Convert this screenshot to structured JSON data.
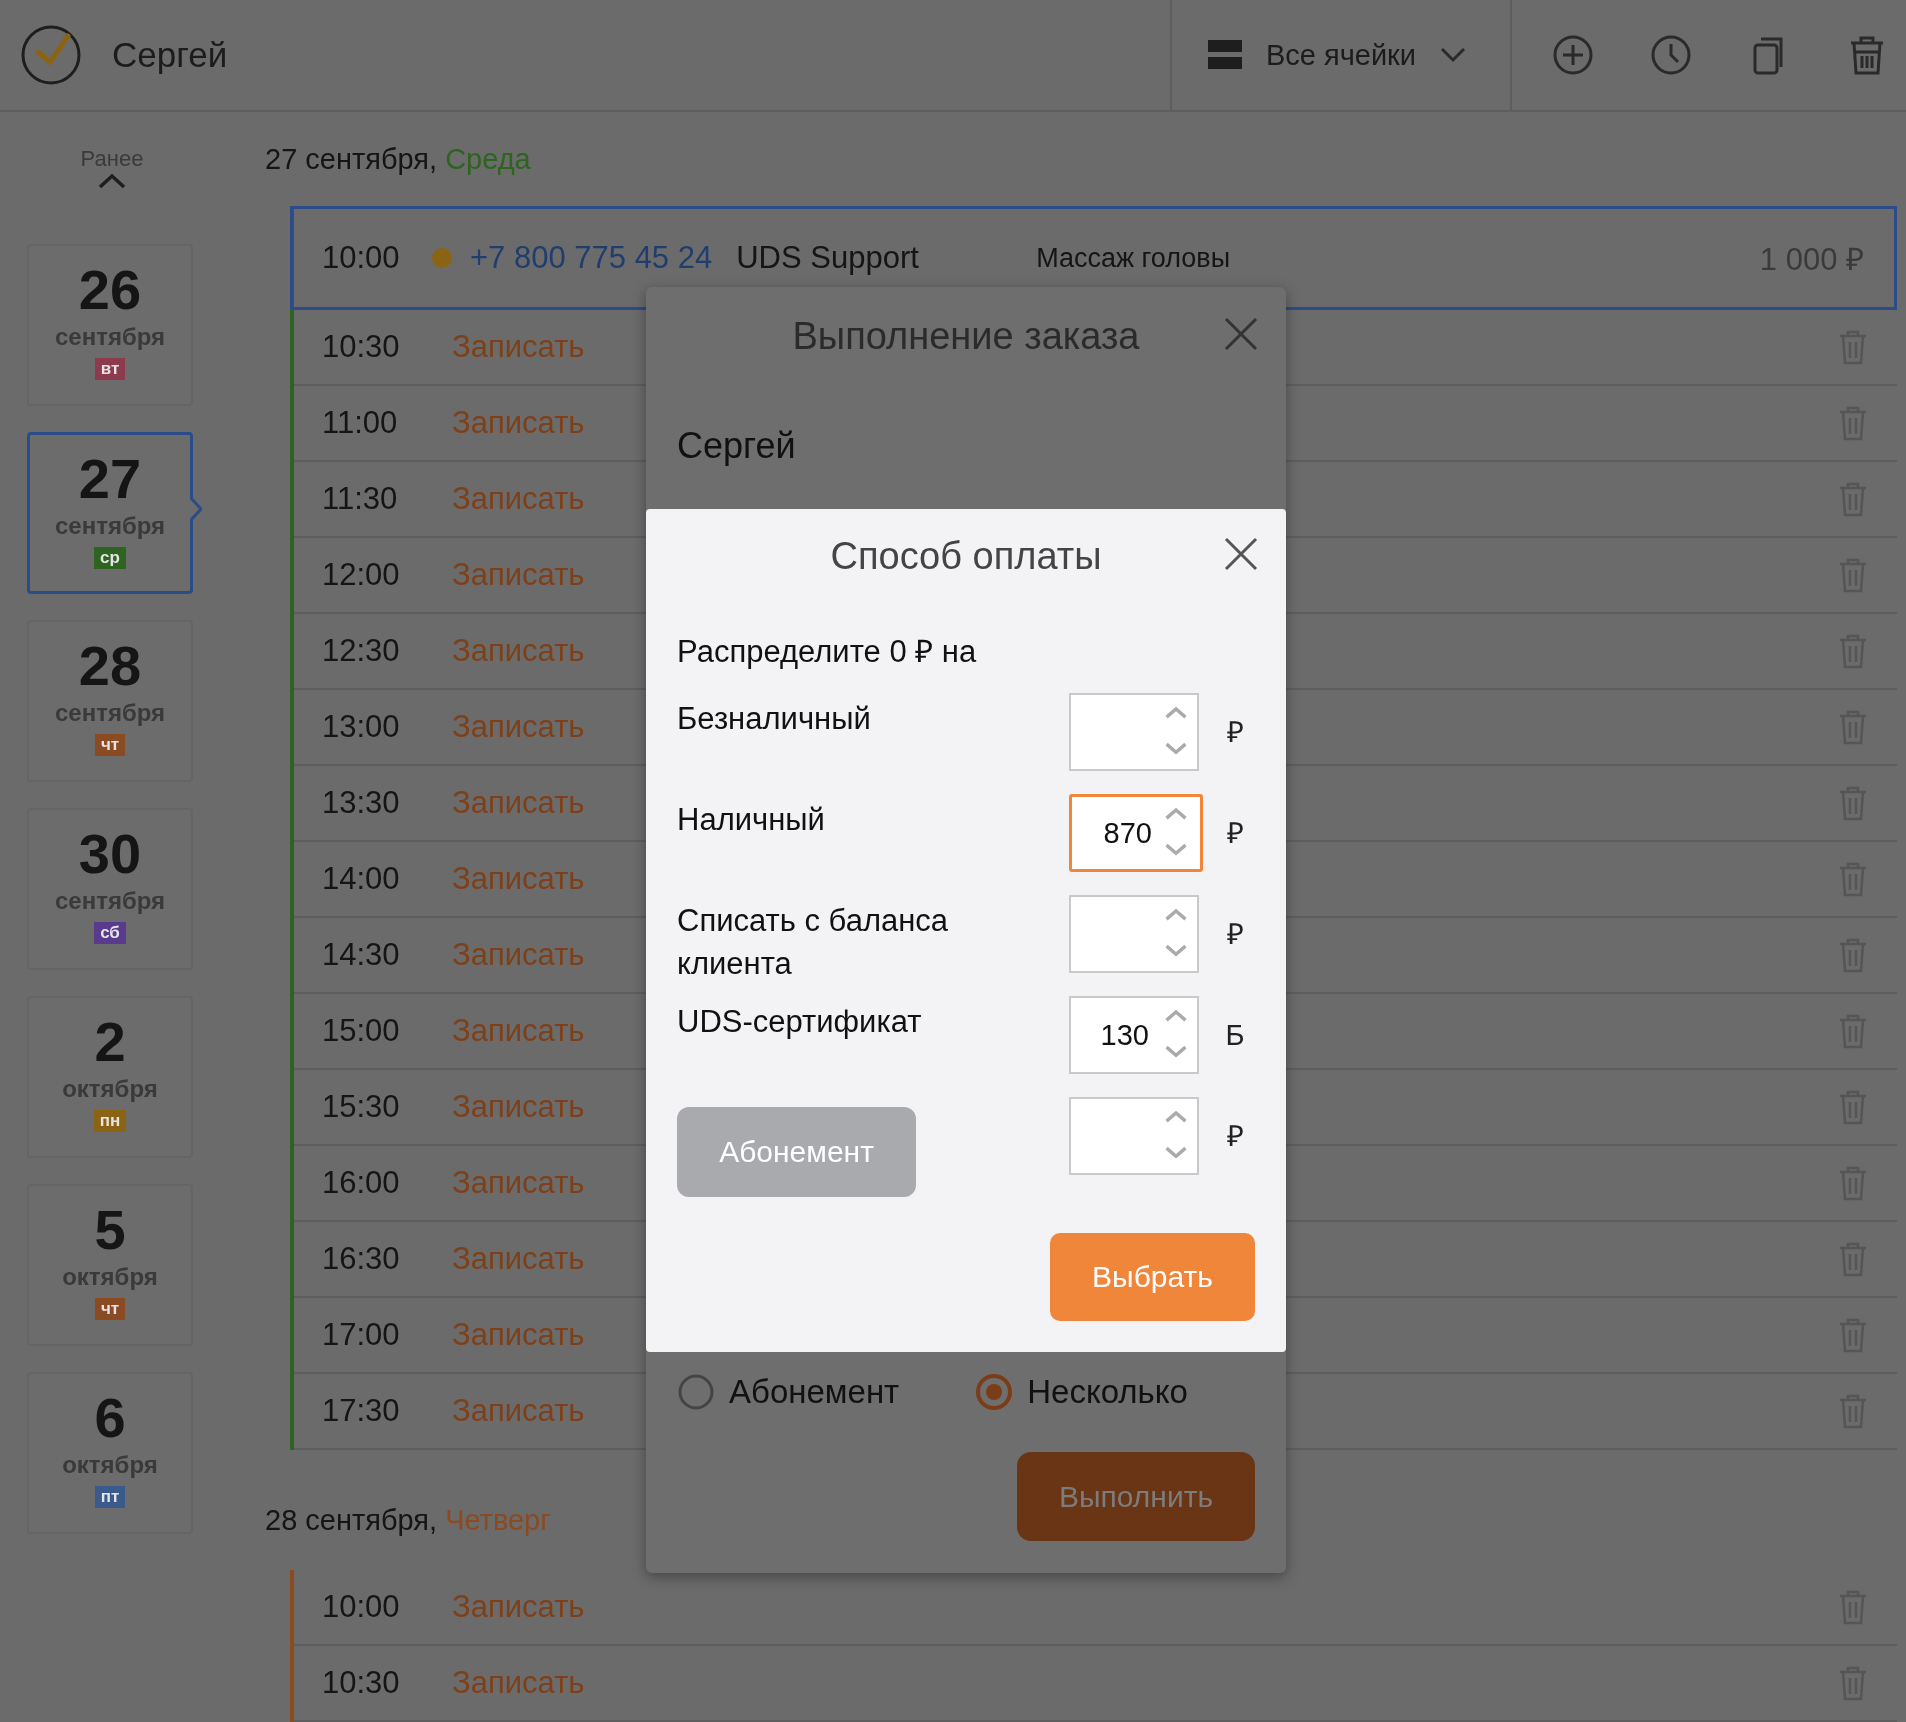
{
  "header": {
    "user_name": "Сергей",
    "filter_label": "Все ячейки"
  },
  "sidebar": {
    "earlier_label": "Ранее",
    "days": [
      {
        "day": "26",
        "month": "сентября",
        "weekday": "вт",
        "color": "#8c3a4c",
        "selected": false
      },
      {
        "day": "27",
        "month": "сентября",
        "weekday": "ср",
        "color": "#2c6420",
        "selected": true
      },
      {
        "day": "28",
        "month": "сентября",
        "weekday": "чт",
        "color": "#8a4a22",
        "selected": false
      },
      {
        "day": "30",
        "month": "сентября",
        "weekday": "сб",
        "color": "#5a3a8c",
        "selected": false
      },
      {
        "day": "2",
        "month": "октября",
        "weekday": "пн",
        "color": "#8a6412",
        "selected": false
      },
      {
        "day": "5",
        "month": "октября",
        "weekday": "чт",
        "color": "#8a4a22",
        "selected": false
      },
      {
        "day": "6",
        "month": "октября",
        "weekday": "пт",
        "color": "#3a5a8c",
        "selected": false
      }
    ]
  },
  "schedule": [
    {
      "date": "27 сентября,",
      "weekday": "Среда",
      "color": "#2c6420",
      "slots": [
        {
          "kind": "booking",
          "time": "10:00",
          "phone": "+7 800 775 45 24",
          "client": "UDS Support",
          "service": "Массаж головы",
          "price": "1 000 ₽",
          "selected": true
        },
        {
          "kind": "free",
          "time": "10:30",
          "action": "Записать",
          "selected": false
        },
        {
          "kind": "free",
          "time": "11:00",
          "action": "Записать",
          "selected": false
        },
        {
          "kind": "free",
          "time": "11:30",
          "action": "Записать",
          "selected": false
        },
        {
          "kind": "free",
          "time": "12:00",
          "action": "Записать",
          "selected": false
        },
        {
          "kind": "free",
          "time": "12:30",
          "action": "Записать",
          "selected": false
        },
        {
          "kind": "free",
          "time": "13:00",
          "action": "Записать",
          "selected": false
        },
        {
          "kind": "free",
          "time": "13:30",
          "action": "Записать",
          "selected": false
        },
        {
          "kind": "free",
          "time": "14:00",
          "action": "Записать",
          "selected": false
        },
        {
          "kind": "free",
          "time": "14:30",
          "action": "Записать",
          "selected": false
        },
        {
          "kind": "free",
          "time": "15:00",
          "action": "Записать",
          "selected": false
        },
        {
          "kind": "free",
          "time": "15:30",
          "action": "Записать",
          "selected": false
        },
        {
          "kind": "free",
          "time": "16:00",
          "action": "Записать",
          "selected": false
        },
        {
          "kind": "free",
          "time": "16:30",
          "action": "Записать",
          "selected": false
        },
        {
          "kind": "free",
          "time": "17:00",
          "action": "Записать",
          "selected": false
        },
        {
          "kind": "free",
          "time": "17:30",
          "action": "Записать",
          "selected": false
        }
      ]
    },
    {
      "date": "28 сентября,",
      "weekday": "Четверг",
      "color": "#8a4a22",
      "slots": [
        {
          "kind": "free",
          "time": "10:00",
          "action": "Записать",
          "selected": false
        },
        {
          "kind": "free",
          "time": "10:30",
          "action": "Записать",
          "selected": false
        }
      ]
    }
  ],
  "order_dialog": {
    "title": "Выполнение заказа",
    "client": "Сергей",
    "options": [
      {
        "label": "Абонемент",
        "selected": false
      },
      {
        "label": "Несколько",
        "selected": true
      }
    ],
    "submit": "Выполнить"
  },
  "payment_dialog": {
    "title": "Способ оплаты",
    "prompt": "Распределите 0 ₽ на",
    "methods": [
      {
        "kind": "label",
        "label": "Безналичный",
        "unit": "₽",
        "focused": false
      },
      {
        "kind": "label",
        "label": "Наличный",
        "value": "870",
        "unit": "₽",
        "focused": true
      },
      {
        "kind": "label",
        "label": "Списать с баланса клиента",
        "unit": "₽",
        "focused": false
      },
      {
        "kind": "label",
        "label": "UDS-сертификат",
        "value": "130",
        "unit": "Б",
        "focused": false
      },
      {
        "kind": "button",
        "label": "Абонемент",
        "unit": "₽",
        "focused": false
      }
    ],
    "submit": "Выбрать"
  }
}
